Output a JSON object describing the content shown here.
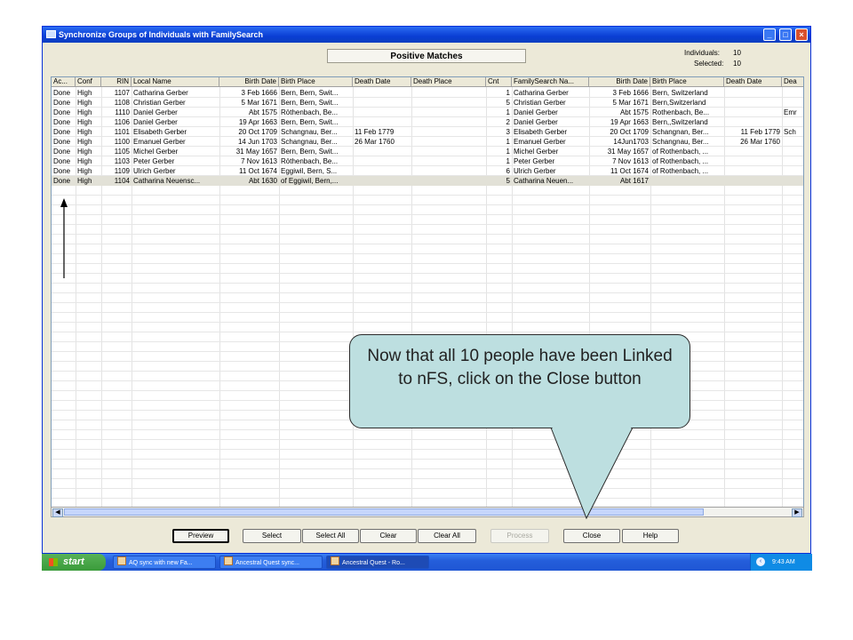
{
  "window": {
    "title": "Synchronize Groups of Individuals with FamilySearch",
    "controls": {
      "minimize": "_",
      "maximize": "□",
      "close": "×"
    }
  },
  "header": {
    "panel_title": "Positive Matches",
    "individuals_label": "Individuals:",
    "individuals_value": "10",
    "selected_label": "Selected:",
    "selected_value": "10"
  },
  "table": {
    "columns": [
      "Ac...",
      "Conf",
      "RIN",
      "Local Name",
      "Birth Date",
      "Birth Place",
      "Death Date",
      "Death Place",
      "Cnt",
      "FamilySearch Na...",
      "Birth Date",
      "Birth Place",
      "Death Date",
      "Dea"
    ],
    "rows": [
      [
        "Done",
        "High",
        "1107",
        "Catharina Gerber",
        "3 Feb 1666",
        "Bern, Bern, Swit...",
        "",
        "",
        "1",
        "Catharina Gerber",
        "3 Feb 1666",
        "Bern, Switzerland",
        "",
        ""
      ],
      [
        "Done",
        "High",
        "1108",
        "Christian Gerber",
        "5 Mar 1671",
        "Bern, Bern, Swit...",
        "",
        "",
        "5",
        "Christian Gerber",
        "5 Mar 1671",
        "Bern,Switzerland",
        "",
        ""
      ],
      [
        "Done",
        "High",
        "1110",
        "Daniel Gerber",
        "Abt 1575",
        "Röthenbach, Be...",
        "",
        "",
        "1",
        "Daniel Gerber",
        "Abt 1575",
        "Rothenbach, Be...",
        "",
        "Emr"
      ],
      [
        "Done",
        "High",
        "1106",
        "Daniel Gerber",
        "19 Apr 1663",
        "Bern, Bern, Swit...",
        "",
        "",
        "2",
        "Daniel Gerber",
        "19 Apr 1663",
        "Bern,,Switzerland",
        "",
        ""
      ],
      [
        "Done",
        "High",
        "1101",
        "Elisabeth Gerber",
        "20 Oct 1709",
        "Schangnau, Ber...",
        "11 Feb 1779",
        "",
        "3",
        "Elisabeth Gerber",
        "20 Oct 1709",
        "Schangnan, Ber...",
        "11 Feb 1779",
        "Sch"
      ],
      [
        "Done",
        "High",
        "1100",
        "Emanuel Gerber",
        "14 Jun 1703",
        "Schangnau, Ber...",
        "26 Mar 1760",
        "",
        "1",
        "Emanuel Gerber",
        "14Jun1703",
        "Schangnau, Ber...",
        "26 Mar 1760",
        ""
      ],
      [
        "Done",
        "High",
        "1105",
        "Michel Gerber",
        "31 May 1657",
        "Bern, Bern, Swit...",
        "",
        "",
        "1",
        "Michel Gerber",
        "31 May 1657",
        "of Rothenbach, ...",
        "",
        ""
      ],
      [
        "Done",
        "High",
        "1103",
        "Peter Gerber",
        "7 Nov 1613",
        "Röthenbach, Be...",
        "",
        "",
        "1",
        "Peter Gerber",
        "7 Nov 1613",
        "of Rothenbach, ...",
        "",
        ""
      ],
      [
        "Done",
        "High",
        "1109",
        "Ulrich Gerber",
        "11 Oct 1674",
        "Eggiwil, Bern, S...",
        "",
        "",
        "6",
        "Ulrich Gerber",
        "11 Oct 1674",
        "of Rothenbach, ...",
        "",
        ""
      ],
      [
        "Done",
        "High",
        "1104",
        "Catharina Neuensc...",
        "Abt 1630",
        "of Eggiwil, Bern,...",
        "",
        "",
        "5",
        "Catharina Neuen...",
        "Abt 1617",
        "",
        "",
        ""
      ]
    ]
  },
  "buttons": {
    "preview": "Preview",
    "select": "Select",
    "select_all": "Select All",
    "clear": "Clear",
    "clear_all": "Clear All",
    "process": "Process",
    "close": "Close",
    "help": "Help"
  },
  "taskbar": {
    "start": "start",
    "tasks": [
      "AQ sync with new Fa...",
      "Ancestral Quest sync...",
      "Ancestral Quest - Ro..."
    ],
    "clock": "9:43 AM"
  },
  "callout": {
    "text": "Now that all 10 people have been Linked to nFS, click on the Close button"
  }
}
